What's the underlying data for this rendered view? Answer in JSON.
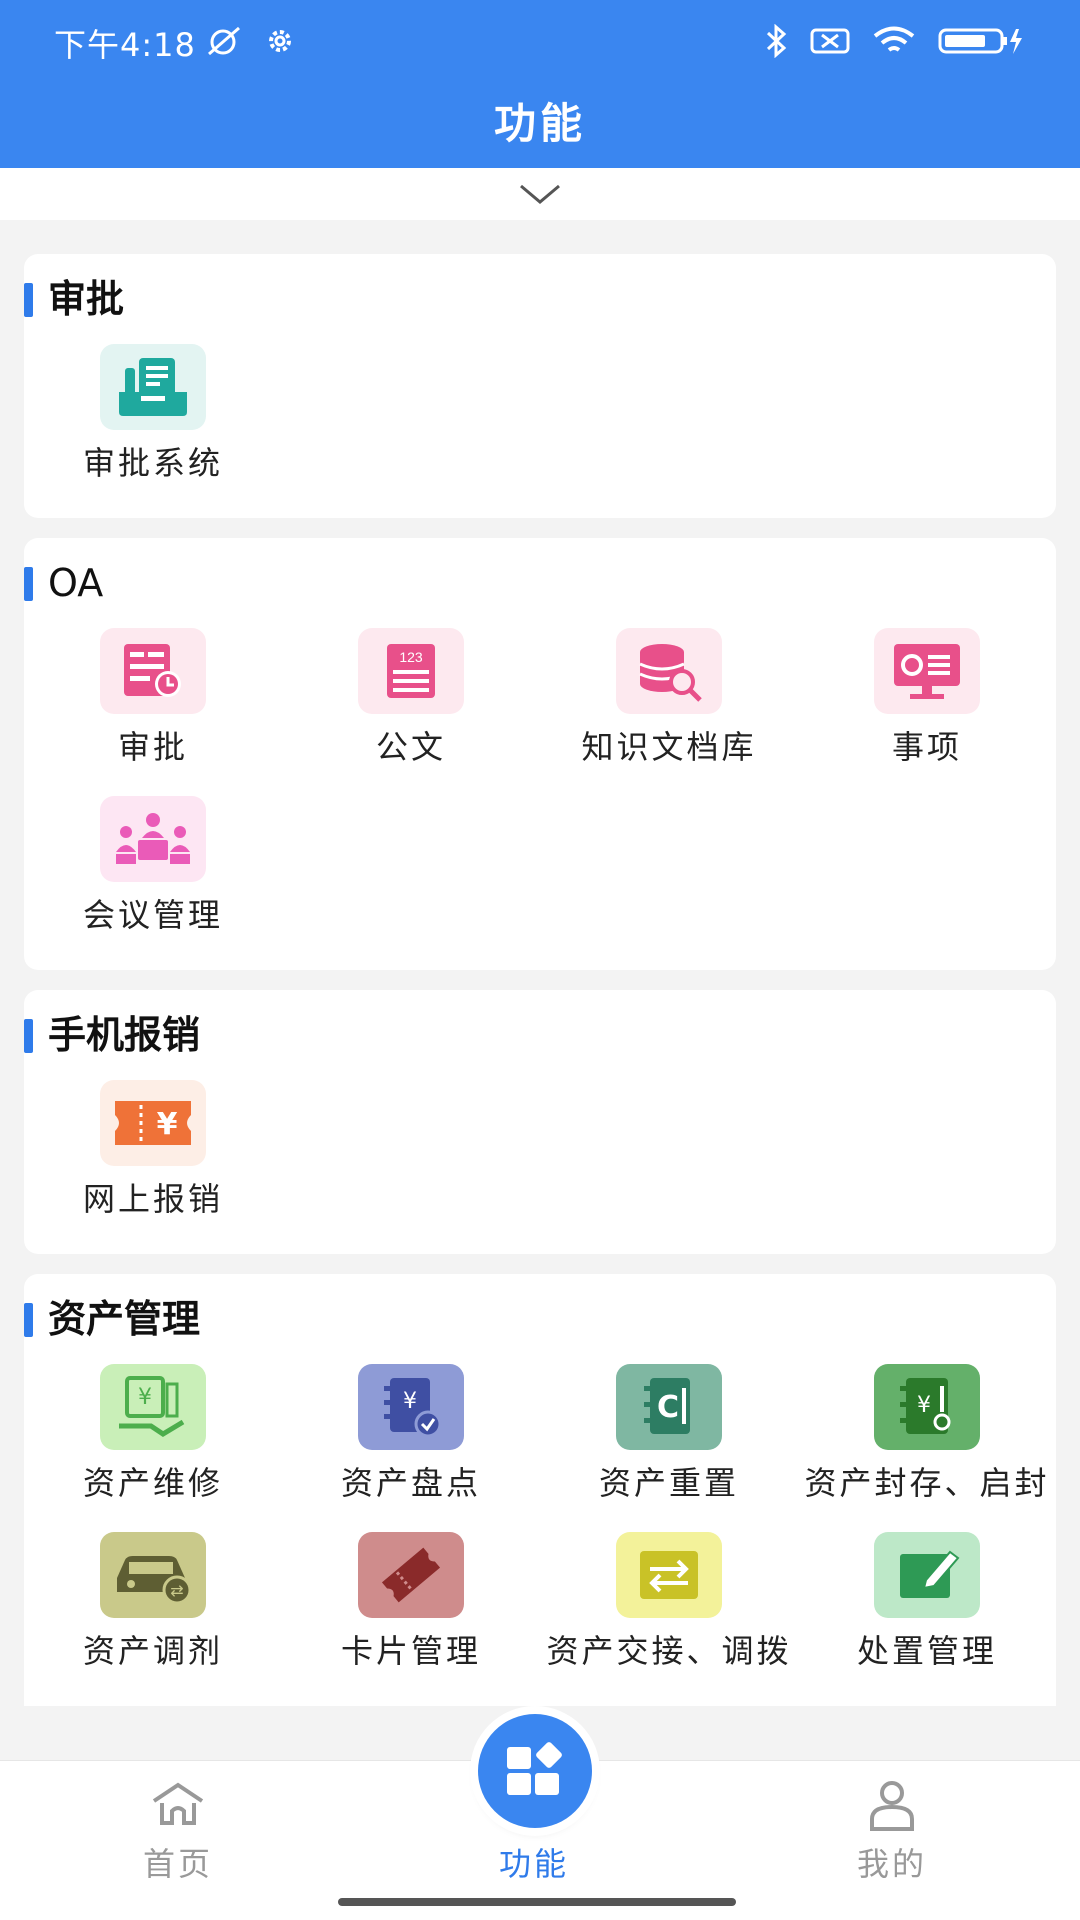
{
  "status_bar": {
    "time": "下午4:18"
  },
  "header": {
    "title": "功能"
  },
  "sections": [
    {
      "title": "审批",
      "items": [
        {
          "label": "审批系统",
          "icon": "inbox-tray-icon",
          "color": "#1fa99e",
          "bg": "#e3f4f2"
        }
      ]
    },
    {
      "title": "OA",
      "items": [
        {
          "label": "审批",
          "icon": "approval-clock-icon",
          "color": "#e8508a",
          "bg": "#fde9ef"
        },
        {
          "label": "公文",
          "icon": "document-123-icon",
          "color": "#e8508a",
          "bg": "#fde9ef"
        },
        {
          "label": "知识文档库",
          "icon": "database-search-icon",
          "color": "#e8508a",
          "bg": "#fde9ef"
        },
        {
          "label": "事项",
          "icon": "monitor-list-icon",
          "color": "#e8508a",
          "bg": "#fde9ef"
        },
        {
          "label": "会议管理",
          "icon": "meeting-icon",
          "color": "#ea5bb8",
          "bg": "#fde6f3"
        }
      ]
    },
    {
      "title": "手机报销",
      "items": [
        {
          "label": "网上报销",
          "icon": "yen-ticket-icon",
          "color": "#ef7238",
          "bg": "#fdeee6"
        }
      ]
    },
    {
      "title": "资产管理",
      "items": [
        {
          "label": "资产维修",
          "icon": "asset-repair-icon",
          "color": "#4cae4c",
          "bg": "#c9efb8"
        },
        {
          "label": "资产盘点",
          "icon": "asset-inventory-icon",
          "color": "#3f4fa3",
          "bg": "#8e9bd6"
        },
        {
          "label": "资产重置",
          "icon": "asset-reset-icon",
          "color": "#2d7d63",
          "bg": "#7fb7a2"
        },
        {
          "label": "资产封存、启封",
          "icon": "asset-seal-icon",
          "color": "#2b7a2b",
          "bg": "#64b06a"
        },
        {
          "label": "资产调剂",
          "icon": "car-transfer-icon",
          "color": "#5e5e33",
          "bg": "#c9c98a"
        },
        {
          "label": "卡片管理",
          "icon": "card-ticket-icon",
          "color": "#8a2a2a",
          "bg": "#cf8c8c"
        },
        {
          "label": "资产交接、调拨",
          "icon": "swap-arrows-icon",
          "color": "#c9c227",
          "bg": "#f3f29a"
        },
        {
          "label": "处置管理",
          "icon": "edit-box-icon",
          "color": "#2e9a55",
          "bg": "#bde8c8"
        }
      ]
    }
  ],
  "tabbar": {
    "home": "首页",
    "function": "功能",
    "mine": "我的"
  },
  "colors": {
    "primary": "#3a86f0",
    "accent_bar": "#2f7bea",
    "inactive_tab": "#999999"
  }
}
